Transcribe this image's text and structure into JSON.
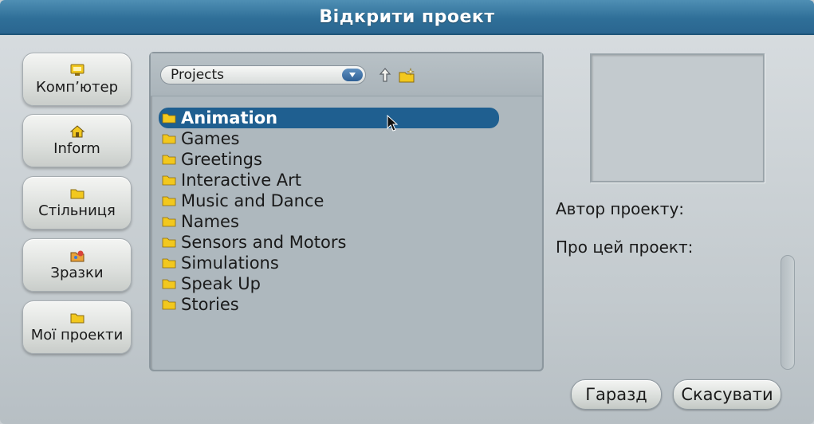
{
  "window": {
    "title": "Відкрити проект"
  },
  "sidebar": {
    "items": [
      {
        "label": "Комп’ютер",
        "icon": "computer-icon"
      },
      {
        "label": "Inform",
        "icon": "home-icon"
      },
      {
        "label": "Стільниця",
        "icon": "folder-icon"
      },
      {
        "label": "Зразки",
        "icon": "examples-icon"
      },
      {
        "label": "Мої проекти",
        "icon": "folder-icon"
      }
    ]
  },
  "browser": {
    "current_path": "Projects",
    "folders": [
      {
        "name": "Animation",
        "selected": true
      },
      {
        "name": "Games",
        "selected": false
      },
      {
        "name": "Greetings",
        "selected": false
      },
      {
        "name": "Interactive Art",
        "selected": false
      },
      {
        "name": "Music and Dance",
        "selected": false
      },
      {
        "name": "Names",
        "selected": false
      },
      {
        "name": "Sensors and Motors",
        "selected": false
      },
      {
        "name": "Simulations",
        "selected": false
      },
      {
        "name": "Speak Up",
        "selected": false
      },
      {
        "name": "Stories",
        "selected": false
      }
    ]
  },
  "details": {
    "author_label": "Автор проекту:",
    "about_label": "Про цей проект:"
  },
  "buttons": {
    "ok_label": "Гаразд",
    "cancel_label": "Скасувати"
  },
  "colors": {
    "title_bar": "#2f6f98",
    "selection": "#1f5f90",
    "folder": "#f2c81e"
  }
}
